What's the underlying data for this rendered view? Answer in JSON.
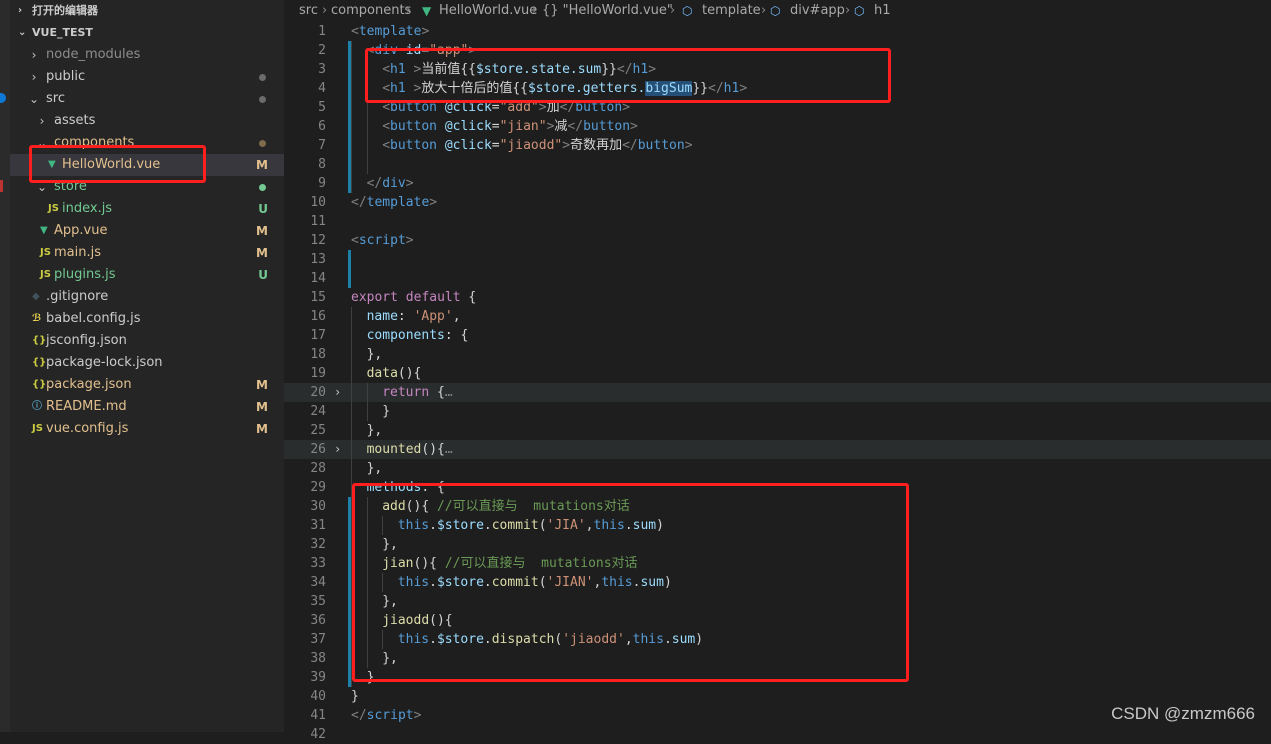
{
  "sidebar": {
    "open_editors_label": "打开的编辑器",
    "project_label": "VUE_TEST",
    "tree": [
      {
        "label": "node_modules",
        "kind": "folder",
        "collapsed": true,
        "status": "",
        "color": "dim"
      },
      {
        "label": "public",
        "kind": "folder",
        "collapsed": true,
        "status": "dot",
        "color": "normal"
      },
      {
        "label": "src",
        "kind": "folder",
        "collapsed": false,
        "status": "dot",
        "color": "normal"
      },
      {
        "label": "assets",
        "kind": "folder",
        "collapsed": true,
        "status": "",
        "color": "normal"
      },
      {
        "label": "components",
        "kind": "folder",
        "collapsed": false,
        "status": "dot",
        "color": "mod"
      },
      {
        "label": "HelloWorld.vue",
        "kind": "vue",
        "status": "M",
        "color": "mod",
        "selected": true
      },
      {
        "label": "store",
        "kind": "folder",
        "collapsed": false,
        "status": "dot-green",
        "color": "untracked"
      },
      {
        "label": "index.js",
        "kind": "js",
        "status": "U",
        "color": "untracked"
      },
      {
        "label": "App.vue",
        "kind": "vue",
        "status": "M",
        "color": "mod"
      },
      {
        "label": "main.js",
        "kind": "js",
        "status": "M",
        "color": "mod"
      },
      {
        "label": "plugins.js",
        "kind": "js",
        "status": "U",
        "color": "untracked"
      },
      {
        "label": ".gitignore",
        "kind": "git",
        "status": "",
        "color": "normal"
      },
      {
        "label": "babel.config.js",
        "kind": "babel",
        "status": "",
        "color": "normal"
      },
      {
        "label": "jsconfig.json",
        "kind": "json",
        "status": "",
        "color": "normal"
      },
      {
        "label": "package-lock.json",
        "kind": "json",
        "status": "",
        "color": "normal"
      },
      {
        "label": "package.json",
        "kind": "json",
        "status": "M",
        "color": "mod"
      },
      {
        "label": "README.md",
        "kind": "info",
        "status": "M",
        "color": "mod"
      },
      {
        "label": "vue.config.js",
        "kind": "js",
        "status": "M",
        "color": "mod"
      }
    ]
  },
  "icons": {
    "vue": "vue-icon",
    "js": "js-icon",
    "json": "json-icon",
    "git": "git-icon",
    "babel": "babel-icon",
    "info": "info-icon"
  },
  "breadcrumb": {
    "p1": "src",
    "p2": "components",
    "p3": "HelloWorld.vue",
    "p4": "{} \"HelloWorld.vue\"",
    "p5": "template",
    "p6": "div#app",
    "p7": "h1"
  },
  "editor": {
    "lines": [
      {
        "n": "1",
        "indent": 0,
        "tokens": [
          [
            "tg",
            "<"
          ],
          [
            "t",
            "template"
          ],
          [
            "tg",
            ">"
          ]
        ]
      },
      {
        "n": "2",
        "indent": 1,
        "tokens": [
          [
            "tg",
            "<"
          ],
          [
            "t",
            "div "
          ],
          [
            "at",
            "id"
          ],
          [
            "pl",
            "="
          ],
          [
            "st",
            "\"app\""
          ],
          [
            "tg",
            ">"
          ]
        ]
      },
      {
        "n": "3",
        "indent": 2,
        "tokens": [
          [
            "tg",
            "<"
          ],
          [
            "t",
            "h1 "
          ],
          [
            "tg",
            ">"
          ],
          [
            "pl",
            "当前值{{"
          ],
          [
            "vb",
            "$store.state.sum"
          ],
          [
            "pl",
            "}}"
          ],
          [
            "tg",
            "</"
          ],
          [
            "t",
            "h1"
          ],
          [
            "tg",
            ">"
          ]
        ]
      },
      {
        "n": "4",
        "indent": 2,
        "tokens": [
          [
            "tg",
            "<"
          ],
          [
            "t",
            "h1 "
          ],
          [
            "tg",
            ">"
          ],
          [
            "pl",
            "放大十倍后的值{{"
          ],
          [
            "vb",
            "$store.getters."
          ],
          [
            "sel",
            "bigSum"
          ],
          [
            "pl",
            "}}"
          ],
          [
            "tg",
            "</"
          ],
          [
            "t",
            "h1"
          ],
          [
            "tg",
            ">"
          ]
        ]
      },
      {
        "n": "5",
        "indent": 2,
        "tokens": [
          [
            "tg",
            "<"
          ],
          [
            "t",
            "button "
          ],
          [
            "at",
            "@click"
          ],
          [
            "pl",
            "="
          ],
          [
            "st",
            "\"add\""
          ],
          [
            "tg",
            ">"
          ],
          [
            "pl",
            "加"
          ],
          [
            "tg",
            "</"
          ],
          [
            "t",
            "button"
          ],
          [
            "tg",
            ">"
          ]
        ]
      },
      {
        "n": "6",
        "indent": 2,
        "tokens": [
          [
            "tg",
            "<"
          ],
          [
            "t",
            "button "
          ],
          [
            "at",
            "@click"
          ],
          [
            "pl",
            "="
          ],
          [
            "st",
            "\"jian\""
          ],
          [
            "tg",
            ">"
          ],
          [
            "pl",
            "减"
          ],
          [
            "tg",
            "</"
          ],
          [
            "t",
            "button"
          ],
          [
            "tg",
            ">"
          ]
        ]
      },
      {
        "n": "7",
        "indent": 2,
        "tokens": [
          [
            "tg",
            "<"
          ],
          [
            "t",
            "button "
          ],
          [
            "at",
            "@click"
          ],
          [
            "pl",
            "="
          ],
          [
            "st",
            "\"jiaodd\""
          ],
          [
            "tg",
            ">"
          ],
          [
            "pl",
            "奇数再加"
          ],
          [
            "tg",
            "</"
          ],
          [
            "t",
            "button"
          ],
          [
            "tg",
            ">"
          ]
        ]
      },
      {
        "n": "8",
        "indent": 2,
        "tokens": []
      },
      {
        "n": "9",
        "indent": 1,
        "tokens": [
          [
            "tg",
            "</"
          ],
          [
            "t",
            "div"
          ],
          [
            "tg",
            ">"
          ]
        ]
      },
      {
        "n": "10",
        "indent": 0,
        "tokens": [
          [
            "tg",
            "</"
          ],
          [
            "t",
            "template"
          ],
          [
            "tg",
            ">"
          ]
        ]
      },
      {
        "n": "11",
        "indent": 0,
        "tokens": []
      },
      {
        "n": "12",
        "indent": 0,
        "tokens": [
          [
            "tg",
            "<"
          ],
          [
            "t",
            "script"
          ],
          [
            "tg",
            ">"
          ]
        ]
      },
      {
        "n": "13",
        "indent": 0,
        "tokens": []
      },
      {
        "n": "14",
        "indent": 0,
        "tokens": []
      },
      {
        "n": "15",
        "indent": 0,
        "tokens": [
          [
            "kw",
            "export "
          ],
          [
            "kw",
            "default "
          ],
          [
            "pl",
            "{"
          ]
        ]
      },
      {
        "n": "16",
        "indent": 1,
        "tokens": [
          [
            "vb",
            "name"
          ],
          [
            "pl",
            ": "
          ],
          [
            "st",
            "'App'"
          ],
          [
            "pl",
            ","
          ]
        ]
      },
      {
        "n": "17",
        "indent": 1,
        "tokens": [
          [
            "vb",
            "components"
          ],
          [
            "pl",
            ": {"
          ]
        ]
      },
      {
        "n": "18",
        "indent": 1,
        "tokens": [
          [
            "pl",
            "},"
          ]
        ]
      },
      {
        "n": "19",
        "indent": 1,
        "tokens": [
          [
            "fn",
            "data"
          ],
          [
            "pl",
            "(){"
          ]
        ]
      },
      {
        "n": "20",
        "indent": 2,
        "tokens": [
          [
            "kw",
            "return "
          ],
          [
            "pl",
            "{"
          ],
          [
            "tg",
            "…"
          ]
        ],
        "fold": true,
        "hl": true
      },
      {
        "n": "24",
        "indent": 2,
        "tokens": [
          [
            "pl",
            "}"
          ]
        ]
      },
      {
        "n": "25",
        "indent": 1,
        "tokens": [
          [
            "pl",
            "},"
          ]
        ]
      },
      {
        "n": "26",
        "indent": 1,
        "tokens": [
          [
            "fn",
            "mounted"
          ],
          [
            "pl",
            "(){"
          ],
          [
            "tg",
            "…"
          ]
        ],
        "fold": true,
        "hl": true
      },
      {
        "n": "28",
        "indent": 1,
        "tokens": [
          [
            "pl",
            "},"
          ]
        ]
      },
      {
        "n": "29",
        "indent": 1,
        "tokens": [
          [
            "vb",
            "methods"
          ],
          [
            "pl",
            ": {"
          ]
        ]
      },
      {
        "n": "30",
        "indent": 2,
        "tokens": [
          [
            "fn",
            "add"
          ],
          [
            "pl",
            "(){ "
          ],
          [
            "cm",
            "//可以直接与  mutations对话"
          ]
        ]
      },
      {
        "n": "31",
        "indent": 3,
        "tokens": [
          [
            "t",
            "this"
          ],
          [
            "pl",
            "."
          ],
          [
            "vb",
            "$store"
          ],
          [
            "pl",
            "."
          ],
          [
            "fn",
            "commit"
          ],
          [
            "pl",
            "("
          ],
          [
            "st",
            "'JIA'"
          ],
          [
            "pl",
            ","
          ],
          [
            "t",
            "this"
          ],
          [
            "pl",
            "."
          ],
          [
            "vb",
            "sum"
          ],
          [
            "pl",
            ")"
          ]
        ]
      },
      {
        "n": "32",
        "indent": 2,
        "tokens": [
          [
            "pl",
            "},"
          ]
        ]
      },
      {
        "n": "33",
        "indent": 2,
        "tokens": [
          [
            "fn",
            "jian"
          ],
          [
            "pl",
            "(){ "
          ],
          [
            "cm",
            "//可以直接与  mutations对话"
          ]
        ]
      },
      {
        "n": "34",
        "indent": 3,
        "tokens": [
          [
            "t",
            "this"
          ],
          [
            "pl",
            "."
          ],
          [
            "vb",
            "$store"
          ],
          [
            "pl",
            "."
          ],
          [
            "fn",
            "commit"
          ],
          [
            "pl",
            "("
          ],
          [
            "st",
            "'JIAN'"
          ],
          [
            "pl",
            ","
          ],
          [
            "t",
            "this"
          ],
          [
            "pl",
            "."
          ],
          [
            "vb",
            "sum"
          ],
          [
            "pl",
            ")"
          ]
        ]
      },
      {
        "n": "35",
        "indent": 2,
        "tokens": [
          [
            "pl",
            "},"
          ]
        ]
      },
      {
        "n": "36",
        "indent": 2,
        "tokens": [
          [
            "fn",
            "jiaodd"
          ],
          [
            "pl",
            "(){"
          ]
        ]
      },
      {
        "n": "37",
        "indent": 3,
        "tokens": [
          [
            "t",
            "this"
          ],
          [
            "pl",
            "."
          ],
          [
            "vb",
            "$store"
          ],
          [
            "pl",
            "."
          ],
          [
            "fn",
            "dispatch"
          ],
          [
            "pl",
            "("
          ],
          [
            "st",
            "'jiaodd'"
          ],
          [
            "pl",
            ","
          ],
          [
            "t",
            "this"
          ],
          [
            "pl",
            "."
          ],
          [
            "vb",
            "sum"
          ],
          [
            "pl",
            ")"
          ]
        ]
      },
      {
        "n": "38",
        "indent": 2,
        "tokens": [
          [
            "pl",
            "},"
          ]
        ]
      },
      {
        "n": "39",
        "indent": 1,
        "tokens": [
          [
            "pl",
            "}"
          ]
        ]
      },
      {
        "n": "40",
        "indent": 0,
        "tokens": [
          [
            "pl",
            "}"
          ]
        ]
      },
      {
        "n": "41",
        "indent": 0,
        "tokens": [
          [
            "tg",
            "</"
          ],
          [
            "t",
            "script"
          ],
          [
            "tg",
            ">"
          ]
        ]
      },
      {
        "n": "42",
        "indent": 0,
        "tokens": []
      }
    ]
  },
  "watermark": "CSDN @zmzm666",
  "colors": {
    "annotation_red": "#ff1f1f",
    "modified": "#e2c08d",
    "untracked": "#73c991",
    "editor_bg": "#1e1e1e",
    "sidebar_bg": "#252526"
  }
}
